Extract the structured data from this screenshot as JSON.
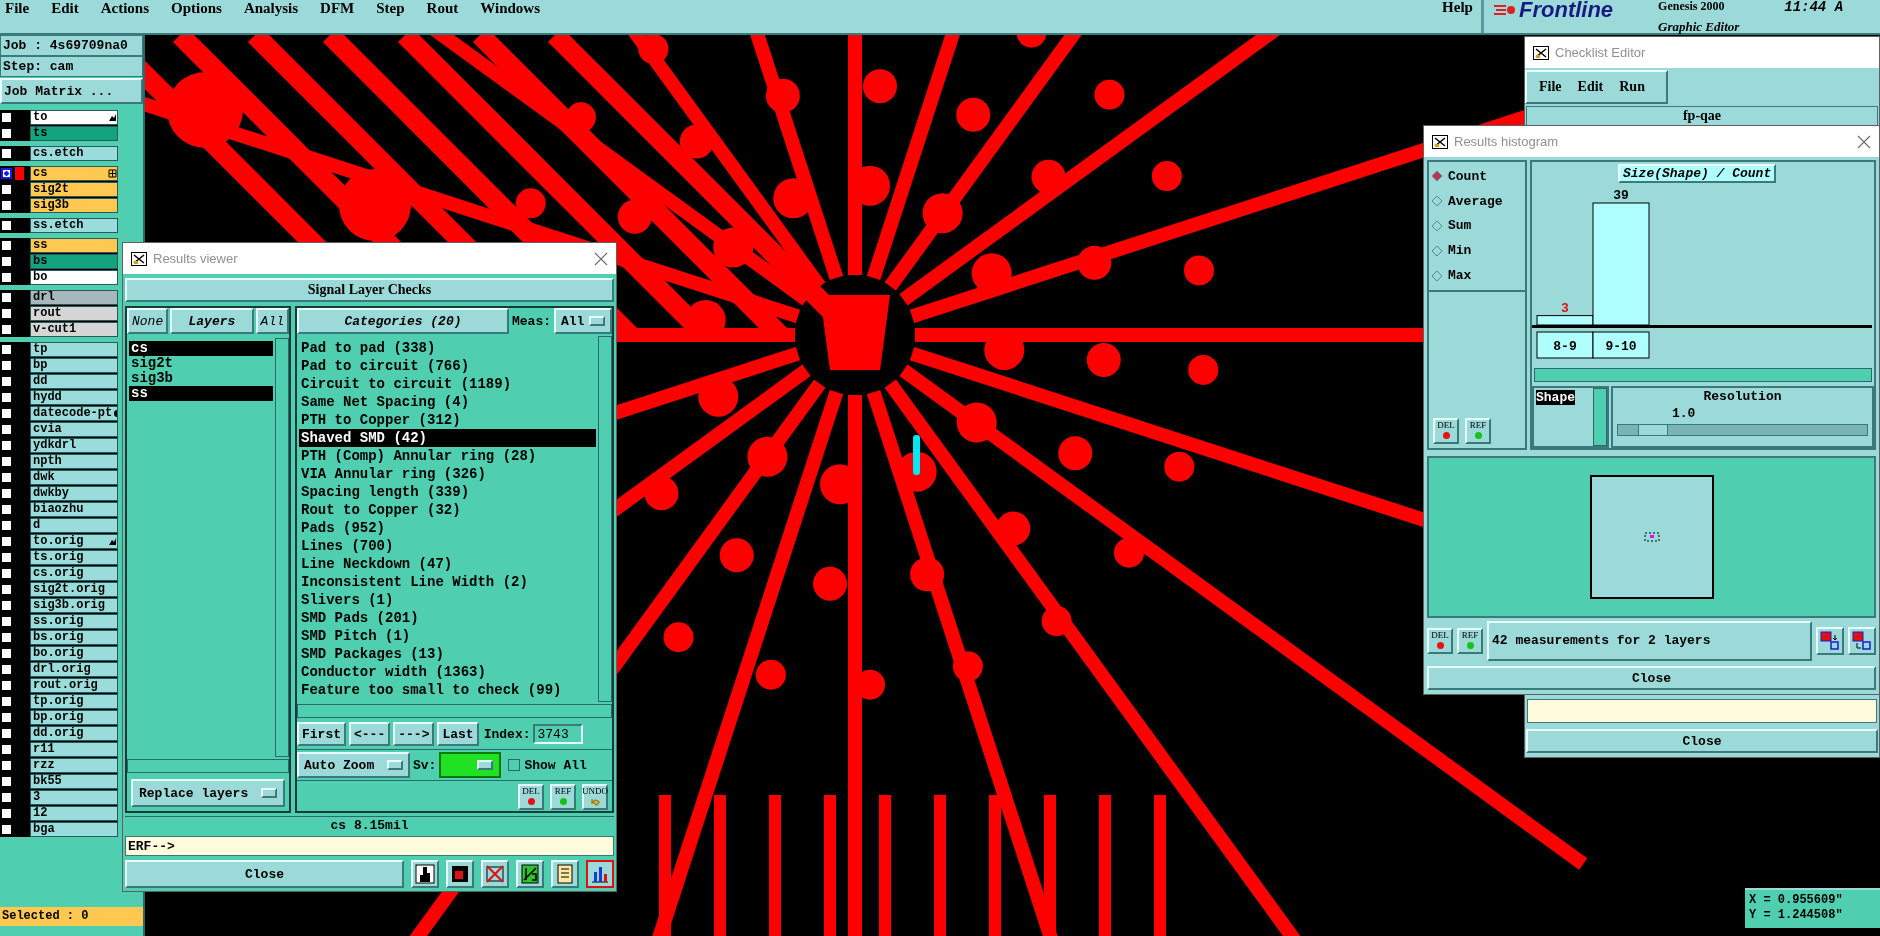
{
  "menu_bar": {
    "items": [
      "File",
      "Edit",
      "Actions",
      "Options",
      "Analysis",
      "DFM",
      "Step",
      "Rout",
      "Windows"
    ],
    "help": "Help"
  },
  "branding": {
    "logo": "Frontline",
    "product": "Genesis 2000",
    "subtitle": "Graphic Editor",
    "clock": "11:44 A"
  },
  "job_panel": {
    "job": "Job : 4s69709na0",
    "step": "Step: cam",
    "matrix_button": "Job Matrix ...",
    "layer_groups": [
      [
        {
          "name": "to",
          "color": "#ffffff",
          "work_layer": false,
          "displayed": false,
          "kind": "hand"
        },
        {
          "name": "ts",
          "color": "#13a37f",
          "work_layer": false,
          "displayed": false
        }
      ],
      [
        {
          "name": "cs.etch",
          "color": "#9adcdc",
          "work_layer": false,
          "displayed": false
        }
      ],
      [
        {
          "name": "cs",
          "color": "#ffc850",
          "work_layer": true,
          "displayed": true,
          "kind": "grid"
        },
        {
          "name": "sig2t",
          "color": "#ffc850",
          "work_layer": false,
          "displayed": false
        },
        {
          "name": "sig3b",
          "color": "#ffc850",
          "work_layer": false,
          "displayed": false
        }
      ],
      [
        {
          "name": "ss.etch",
          "color": "#9adcdc",
          "work_layer": false,
          "displayed": false
        }
      ],
      [
        {
          "name": "ss",
          "color": "#ffc850",
          "work_layer": false,
          "displayed": false
        },
        {
          "name": "bs",
          "color": "#13a37f",
          "work_layer": false,
          "displayed": false
        },
        {
          "name": "bo",
          "color": "#ffffff",
          "work_layer": false,
          "displayed": false
        }
      ],
      [
        {
          "name": "drl",
          "color": "#a6b8bc",
          "work_layer": false,
          "displayed": false
        },
        {
          "name": "rout",
          "color": "#d6d6d6",
          "work_layer": false,
          "displayed": false
        },
        {
          "name": "v-cut1",
          "color": "#d6d6d6",
          "work_layer": false,
          "displayed": false
        }
      ],
      [
        {
          "name": "tp",
          "color": "#9adcdc",
          "work_layer": false,
          "displayed": false
        },
        {
          "name": "bp",
          "color": "#9adcdc",
          "work_layer": false,
          "displayed": false
        },
        {
          "name": "dd",
          "color": "#9adcdc",
          "work_layer": false,
          "displayed": false
        },
        {
          "name": "hydd",
          "color": "#9adcdc",
          "work_layer": false,
          "displayed": false
        },
        {
          "name": "datecode-pt",
          "color": "#9adcdc",
          "work_layer": false,
          "displayed": false,
          "kind": "dot"
        },
        {
          "name": "cvia",
          "color": "#9adcdc",
          "work_layer": false,
          "displayed": false
        },
        {
          "name": "ydkdrl",
          "color": "#9adcdc",
          "work_layer": false,
          "displayed": false
        },
        {
          "name": "npth",
          "color": "#9adcdc",
          "work_layer": false,
          "displayed": false
        },
        {
          "name": "dwk",
          "color": "#9adcdc",
          "work_layer": false,
          "displayed": false
        },
        {
          "name": "dwkby",
          "color": "#9adcdc",
          "work_layer": false,
          "displayed": false
        },
        {
          "name": "biaozhu",
          "color": "#9adcdc",
          "work_layer": false,
          "displayed": false
        },
        {
          "name": "d",
          "color": "#9adcdc",
          "work_layer": false,
          "displayed": false
        },
        {
          "name": "to.orig",
          "color": "#9adcdc",
          "work_layer": false,
          "displayed": false,
          "kind": "hand"
        },
        {
          "name": "ts.orig",
          "color": "#9adcdc",
          "work_layer": false,
          "displayed": false
        },
        {
          "name": "cs.orig",
          "color": "#9adcdc",
          "work_layer": false,
          "displayed": false
        },
        {
          "name": "sig2t.orig",
          "color": "#9adcdc",
          "work_layer": false,
          "displayed": false
        },
        {
          "name": "sig3b.orig",
          "color": "#9adcdc",
          "work_layer": false,
          "displayed": false
        },
        {
          "name": "ss.orig",
          "color": "#9adcdc",
          "work_layer": false,
          "displayed": false
        },
        {
          "name": "bs.orig",
          "color": "#9adcdc",
          "work_layer": false,
          "displayed": false
        },
        {
          "name": "bo.orig",
          "color": "#9adcdc",
          "work_layer": false,
          "displayed": false
        },
        {
          "name": "drl.orig",
          "color": "#9adcdc",
          "work_layer": false,
          "displayed": false
        },
        {
          "name": "rout.orig",
          "color": "#9adcdc",
          "work_layer": false,
          "displayed": false
        },
        {
          "name": "tp.orig",
          "color": "#9adcdc",
          "work_layer": false,
          "displayed": false
        },
        {
          "name": "bp.orig",
          "color": "#9adcdc",
          "work_layer": false,
          "displayed": false
        },
        {
          "name": "dd.orig",
          "color": "#9adcdc",
          "work_layer": false,
          "displayed": false
        },
        {
          "name": "r11",
          "color": "#9adcdc",
          "work_layer": false,
          "displayed": false
        },
        {
          "name": "rzz",
          "color": "#9adcdc",
          "work_layer": false,
          "displayed": false
        },
        {
          "name": "bk55",
          "color": "#9adcdc",
          "work_layer": false,
          "displayed": false
        },
        {
          "name": "3",
          "color": "#9adcdc",
          "work_layer": false,
          "displayed": false
        },
        {
          "name": "12",
          "color": "#9adcdc",
          "work_layer": false,
          "displayed": false
        },
        {
          "name": "bga",
          "color": "#9adcdc",
          "work_layer": false,
          "displayed": false
        }
      ]
    ],
    "selection": "Selected : 0"
  },
  "results_viewer": {
    "title": "Results viewer",
    "heading": "Signal Layer Checks",
    "layer_buttons": [
      {
        "label": "None",
        "kind": "italic"
      },
      {
        "label": "Layers",
        "kind": "bold"
      },
      {
        "label": "All",
        "kind": "italic"
      }
    ],
    "layers": [
      {
        "name": "cs",
        "selected": true
      },
      {
        "name": "sig2t",
        "selected": false
      },
      {
        "name": "sig3b",
        "selected": false
      },
      {
        "name": "ss",
        "selected": true
      }
    ],
    "replace_mode": "Replace layers",
    "categories_button": "Categories (20)",
    "meas_label": "Meas:",
    "meas_value": "All",
    "categories": [
      {
        "name": "Pad to pad (338)",
        "selected": false
      },
      {
        "name": "Pad to circuit (766)",
        "selected": false
      },
      {
        "name": "Circuit to circuit (1189)",
        "selected": false
      },
      {
        "name": "Same Net Spacing (4)",
        "selected": false
      },
      {
        "name": "PTH to Copper (312)",
        "selected": false
      },
      {
        "name": "Shaved SMD (42)",
        "selected": true
      },
      {
        "name": "PTH (Comp) Annular ring (28)",
        "selected": false
      },
      {
        "name": "VIA Annular ring (326)",
        "selected": false
      },
      {
        "name": "Spacing length (339)",
        "selected": false
      },
      {
        "name": "Rout to Copper (32)",
        "selected": false
      },
      {
        "name": "Pads (952)",
        "selected": false
      },
      {
        "name": "Lines (700)",
        "selected": false
      },
      {
        "name": "Line Neckdown (47)",
        "selected": false
      },
      {
        "name": "Inconsistent Line Width (2)",
        "selected": false
      },
      {
        "name": "Slivers (1)",
        "selected": false
      },
      {
        "name": "SMD Pads (201)",
        "selected": false
      },
      {
        "name": "SMD Pitch (1)",
        "selected": false
      },
      {
        "name": "SMD Packages (13)",
        "selected": false
      },
      {
        "name": "Conductor width (1363)",
        "selected": false
      },
      {
        "name": "Feature too small to check (99)",
        "selected": false
      }
    ],
    "nav": [
      "First",
      "<---",
      "--->",
      "Last"
    ],
    "index_label": "Index:",
    "index_value": "3743",
    "zoom_mode": "Auto Zoom",
    "sv_label": "Sv:",
    "sv_swatch": {
      "color": "#22e022"
    },
    "show_all": {
      "label": "Show All",
      "checked": false
    },
    "tools": [
      {
        "label": "DEL",
        "kind": "dot",
        "color": "#e81010"
      },
      {
        "label": "REF",
        "kind": "dot",
        "color": "#18c018"
      },
      {
        "label": "UNDO",
        "kind": "undo"
      }
    ],
    "status": "cs 8.15mil",
    "erf_prompt": "ERF-->",
    "close_label": "Close",
    "bottom_tools": [
      {
        "kind": "figure",
        "selected": false
      },
      {
        "kind": "delete",
        "selected": false
      },
      {
        "kind": "crossed",
        "selected": false
      },
      {
        "kind": "split",
        "selected": false
      },
      {
        "kind": "report",
        "selected": false
      },
      {
        "kind": "histogram",
        "selected": true
      }
    ]
  },
  "checklist_editor": {
    "title": "Checklist Editor",
    "menu": [
      "File",
      "Edit",
      "Run"
    ],
    "checklist": "fp-qae",
    "close_label": "Close"
  },
  "results_histogram": {
    "title": "Results histogram",
    "modes": [
      {
        "label": "Count",
        "selected": true
      },
      {
        "label": "Average",
        "selected": false
      },
      {
        "label": "Sum",
        "selected": false
      },
      {
        "label": "Min",
        "selected": false
      },
      {
        "label": "Max",
        "selected": false
      }
    ],
    "chart_data": {
      "type": "bar",
      "title": "Size(Shape) / Count",
      "categories": [
        "8-9",
        "9-10"
      ],
      "values": [
        3,
        39
      ],
      "ylim": [
        0,
        39
      ],
      "data_labels": true
    },
    "attributes": [
      {
        "label": "Shape",
        "selected": true
      }
    ],
    "resolution_label": "Resolution",
    "resolution_value": "1.0",
    "resolution": {
      "level": 0.08
    },
    "side_tools": [
      {
        "label": "DEL",
        "color": "#e81010"
      },
      {
        "label": "REF",
        "color": "#18c018"
      }
    ],
    "bottom_tools": [
      {
        "label": "DEL",
        "color": "#e81010"
      },
      {
        "label": "REF",
        "color": "#18c018"
      }
    ],
    "summary": "42 measurements for 2 layers",
    "close_label": "Close"
  },
  "coordinates": [
    "X = 0.955609\"",
    "Y = 1.244508\""
  ]
}
